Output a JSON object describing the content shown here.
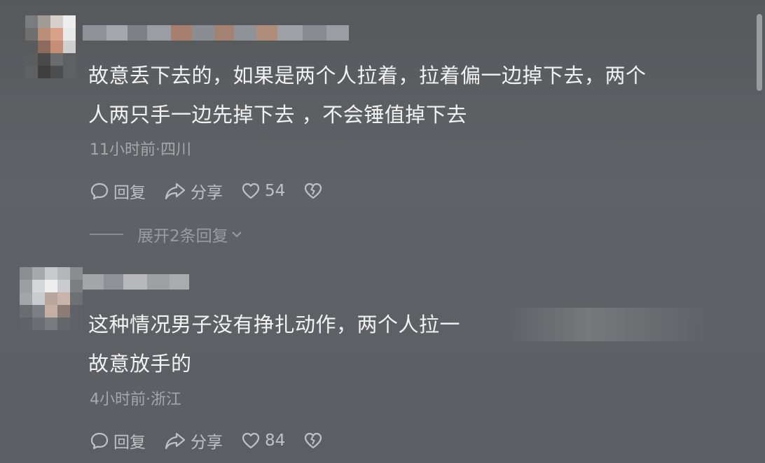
{
  "comments": [
    {
      "text_line1": "故意丢下去的，如果是两个人拉着，拉着偏一边掉下去，两个",
      "text_line2": "人两只手一边先掉下去 ，不会锤值掉下去",
      "meta": "11小时前·四川",
      "reply_label": "回复",
      "share_label": "分享",
      "like_count": "54"
    },
    {
      "text_line1": "这种情况男子没有挣扎动作，两个人拉一",
      "text_line2": "故意放手的",
      "meta": "4小时前·浙江",
      "reply_label": "回复",
      "share_label": "分享",
      "like_count": "84"
    }
  ],
  "expand_replies_label": "展开2条回复",
  "icons": {
    "reply": "comment-bubble-icon",
    "share": "share-arrow-icon",
    "like": "heart-icon",
    "dislike": "broken-heart-icon",
    "expand": "chevron-down-icon"
  },
  "colors": {
    "background": "#5b5f63",
    "text": "#f2f2f2",
    "meta": "#a5a8ab"
  }
}
